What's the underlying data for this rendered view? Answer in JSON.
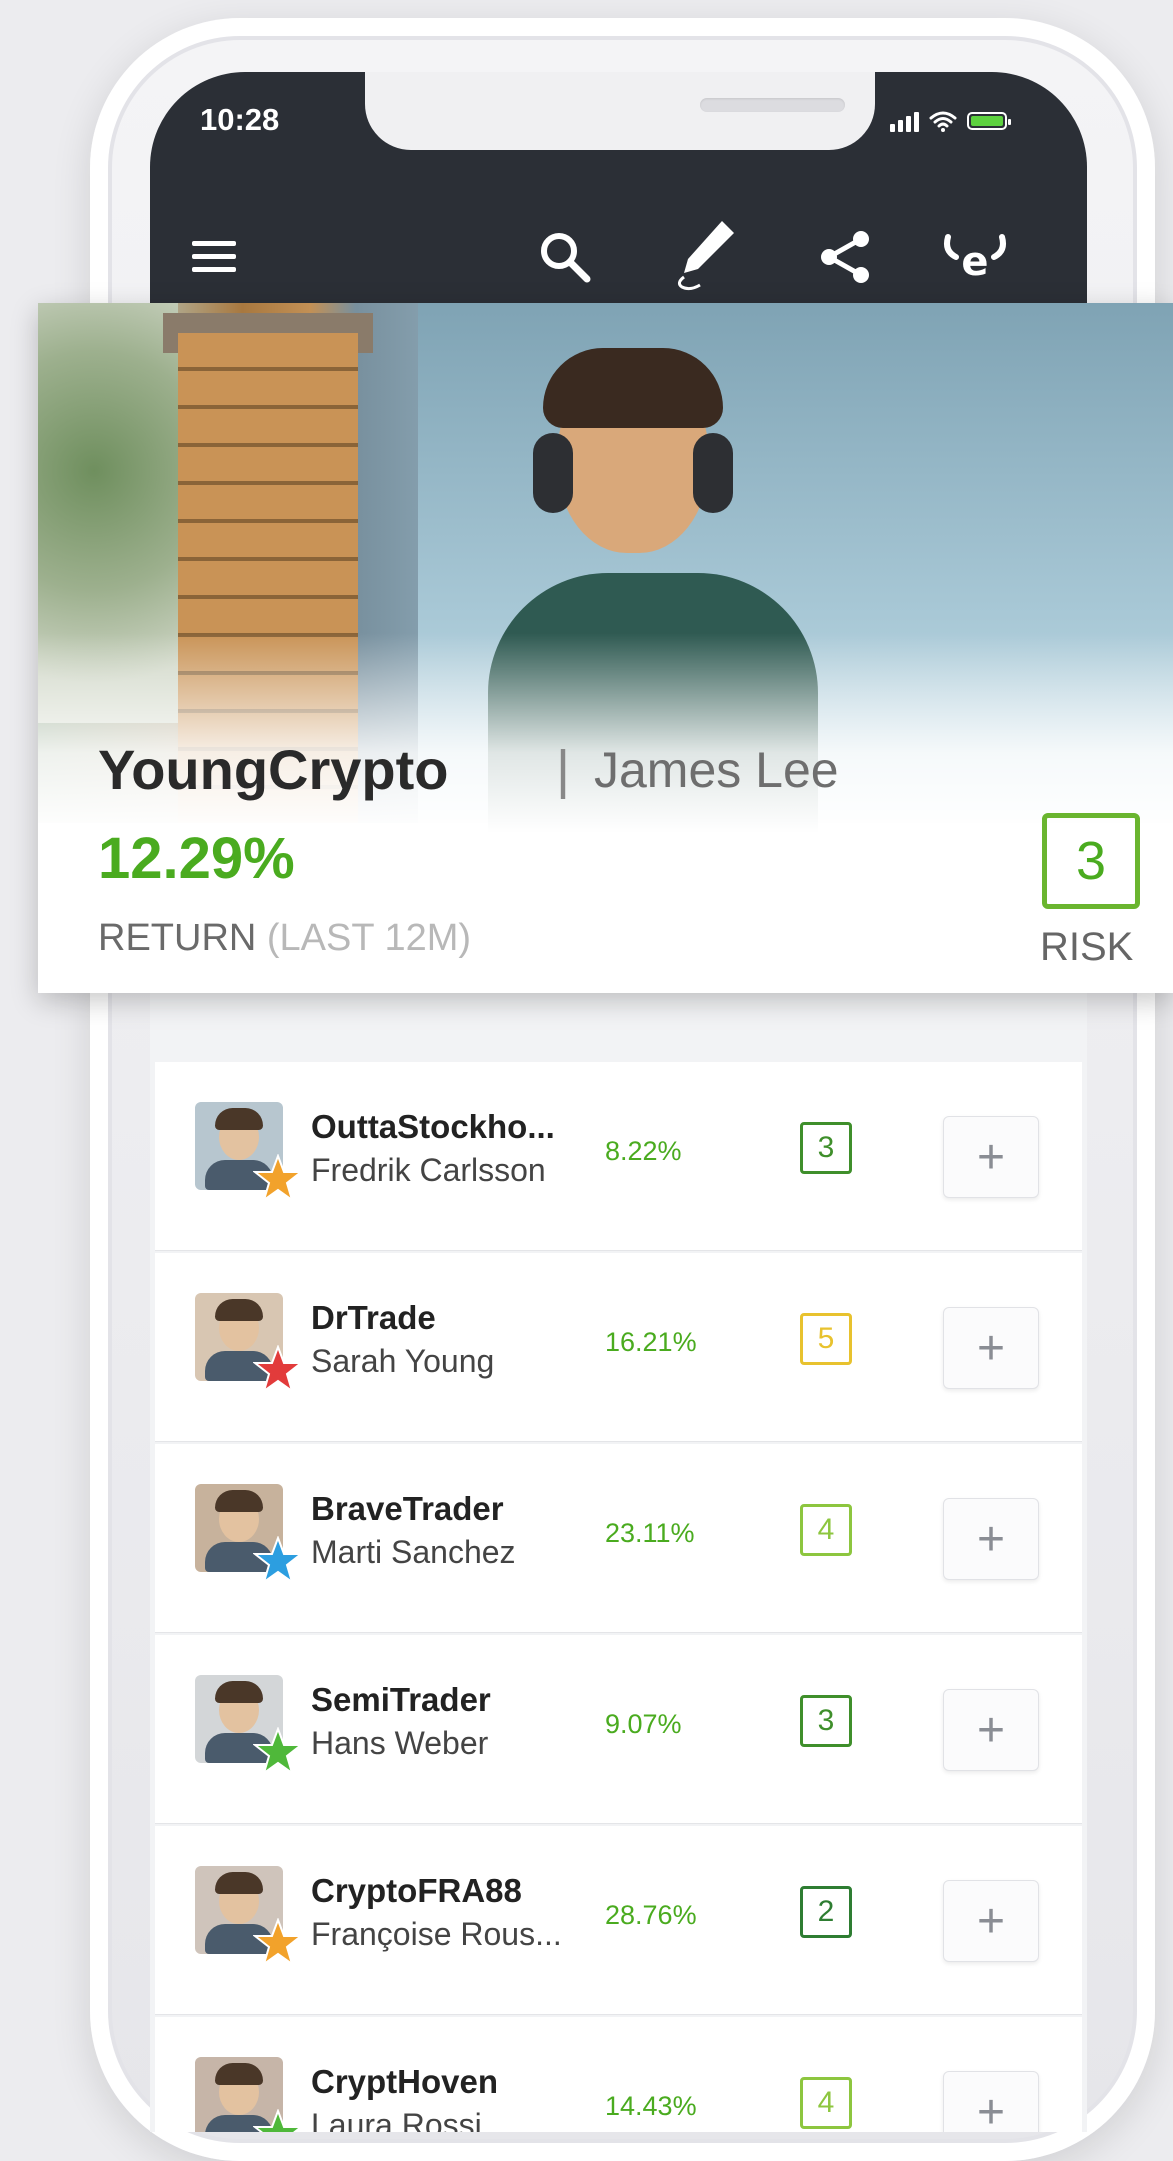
{
  "status_bar": {
    "time": "10:28"
  },
  "nav": {
    "icons": [
      "menu-icon",
      "search-icon",
      "edit-pencil-icon",
      "share-icon",
      "etoro-logo-icon"
    ]
  },
  "featured": {
    "username": "YoungCrypto",
    "separator": "|",
    "real_name": "James Lee",
    "return_value": "12.29%",
    "return_label": "RETURN",
    "return_period": "(LAST 12M)",
    "risk_value": "3",
    "risk_label": "RISK"
  },
  "colors": {
    "accent_green": "#4aab1f",
    "topbar": "#2b2f36",
    "risk_2": "#2e7d32",
    "risk_3": "#3f8f2b",
    "risk_4": "#8dc63f",
    "risk_5": "#e8c22e"
  },
  "traders": [
    {
      "username": "OuttaStockho...",
      "name": "Fredrik Carlsson",
      "return": "8.22%",
      "risk": "3",
      "star": "#f2a22b",
      "avatar": "#b7c6cf"
    },
    {
      "username": "DrTrade",
      "name": "Sarah Young",
      "return": "16.21%",
      "risk": "5",
      "star": "#e23b3b",
      "avatar": "#d8c6b2"
    },
    {
      "username": "BraveTrader",
      "name": "Marti Sanchez",
      "return": "23.11%",
      "risk": "4",
      "star": "#2c9ee0",
      "avatar": "#c7b29c"
    },
    {
      "username": "SemiTrader",
      "name": "Hans Weber",
      "return": "9.07%",
      "risk": "3",
      "star": "#4fb83a",
      "avatar": "#d3d6d8"
    },
    {
      "username": "CryptoFRA88",
      "name": "Françoise Rous...",
      "return": "28.76%",
      "risk": "2",
      "star": "#f2a22b",
      "avatar": "#cfc4bb"
    },
    {
      "username": "CryptHoven",
      "name": "Laura Rossi",
      "return": "14.43%",
      "risk": "4",
      "star": "#4fb83a",
      "avatar": "#c6b5a8"
    }
  ],
  "add_label": "+"
}
